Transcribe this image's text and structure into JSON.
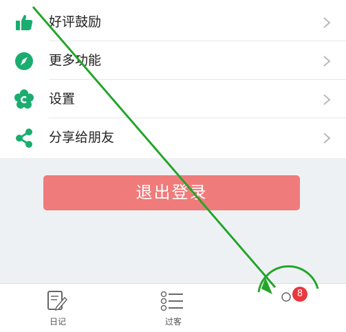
{
  "menu": {
    "items": [
      {
        "label": "好评鼓励",
        "icon": "thumbs-up-icon"
      },
      {
        "label": "更多功能",
        "icon": "compass-icon"
      },
      {
        "label": "设置",
        "icon": "gear-icon"
      },
      {
        "label": "分享给朋友",
        "icon": "share-icon"
      }
    ]
  },
  "logout": {
    "label": "退出登录"
  },
  "tabbar": {
    "tabs": [
      {
        "label": "日记",
        "icon": "diary-icon"
      },
      {
        "label": "过客",
        "icon": "list-icon"
      },
      {
        "label": "",
        "icon": "profile-icon"
      }
    ],
    "badge": "8"
  },
  "colors": {
    "accent_green": "#1aad6f",
    "logout_red": "#f07b7b",
    "badge_red": "#e9383f",
    "annotation_green": "#22a52a"
  }
}
